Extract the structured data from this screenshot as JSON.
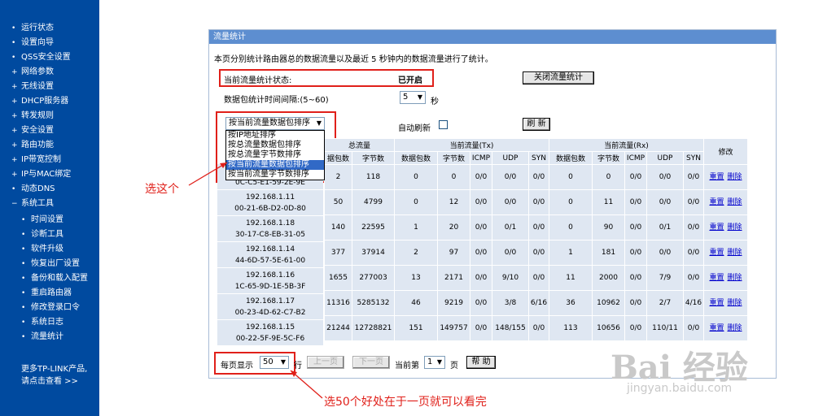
{
  "sidebar": {
    "items": [
      {
        "label": "运行状态",
        "bullet": "•"
      },
      {
        "label": "设置向导",
        "bullet": "•"
      },
      {
        "label": "QSS安全设置",
        "bullet": "•"
      },
      {
        "label": "网络参数",
        "bullet": "+"
      },
      {
        "label": "无线设置",
        "bullet": "+"
      },
      {
        "label": "DHCP服务器",
        "bullet": "+"
      },
      {
        "label": "转发规则",
        "bullet": "+"
      },
      {
        "label": "安全设置",
        "bullet": "+"
      },
      {
        "label": "路由功能",
        "bullet": "+"
      },
      {
        "label": "IP带宽控制",
        "bullet": "+"
      },
      {
        "label": "IP与MAC绑定",
        "bullet": "+"
      },
      {
        "label": "动态DNS",
        "bullet": "•"
      },
      {
        "label": "系统工具",
        "bullet": "−"
      }
    ],
    "sub_items": [
      "时间设置",
      "诊断工具",
      "软件升级",
      "恢复出厂设置",
      "备份和载入配置",
      "重启路由器",
      "修改登录口令",
      "系统日志",
      "流量统计"
    ],
    "more_line1": "更多TP-LINK产品,",
    "more_line2": "请点击查看 >>"
  },
  "panel": {
    "title": "流量统计",
    "description": "本页分别统计路由器总的数据流量以及最近 5 秒钟内的数据流量进行了统计。",
    "status_label": "当前流量统计状态:",
    "status_value": "已开启",
    "close_button": "关闭流量统计",
    "interval_label": "数据包统计时间间隔:(5~60)",
    "interval_value": "5",
    "interval_unit": "秒",
    "sort_selected": "按当前流量数据包排序",
    "auto_refresh_label": "自动刷新",
    "refresh_button": "刷 新",
    "sort_options": [
      "按IP地址排序",
      "按总流量数据包排序",
      "按总流量字节数排序",
      "按当前流量数据包排序",
      "按当前流量字节数排序"
    ],
    "table": {
      "group_total": "总流量",
      "group_tx": "当前流量(Tx)",
      "group_rx": "当前流量(Rx)",
      "group_edit": "修改",
      "sub_total": [
        "据包数",
        "字节数"
      ],
      "sub_current": [
        "数据包数",
        "字节数",
        "ICMP",
        "UDP",
        "SYN"
      ],
      "reset_link": "重置",
      "delete_link": "删除",
      "rows": [
        {
          "ip": "",
          "mac": "0C-C5-E1-59-2E-9E",
          "total_pkts": "2",
          "total_bytes": "118",
          "tx": [
            "0",
            "0",
            "0/0",
            "0/0",
            "0/0"
          ],
          "rx": [
            "0",
            "0",
            "0/0",
            "0/0",
            "0/0"
          ]
        },
        {
          "ip": "192.168.1.11",
          "mac": "00-21-6B-D2-0D-80",
          "total_pkts": "50",
          "total_bytes": "4799",
          "tx": [
            "0",
            "12",
            "0/0",
            "0/0",
            "0/0"
          ],
          "rx": [
            "0",
            "11",
            "0/0",
            "0/0",
            "0/0"
          ]
        },
        {
          "ip": "192.168.1.18",
          "mac": "30-17-C8-EB-31-05",
          "total_pkts": "140",
          "total_bytes": "22595",
          "tx": [
            "1",
            "20",
            "0/0",
            "0/1",
            "0/0"
          ],
          "rx": [
            "0",
            "90",
            "0/0",
            "0/1",
            "0/0"
          ]
        },
        {
          "ip": "192.168.1.14",
          "mac": "44-6D-57-5E-61-00",
          "total_pkts": "377",
          "total_bytes": "37914",
          "tx": [
            "2",
            "97",
            "0/0",
            "0/0",
            "0/0"
          ],
          "rx": [
            "1",
            "181",
            "0/0",
            "0/0",
            "0/0"
          ]
        },
        {
          "ip": "192.168.1.16",
          "mac": "1C-65-9D-1E-5B-3F",
          "total_pkts": "1655",
          "total_bytes": "277003",
          "tx": [
            "13",
            "2171",
            "0/0",
            "9/10",
            "0/0"
          ],
          "rx": [
            "11",
            "2000",
            "0/0",
            "7/9",
            "0/0"
          ]
        },
        {
          "ip": "192.168.1.17",
          "mac": "00-23-4D-62-C7-B2",
          "total_pkts": "11316",
          "total_bytes": "5285132",
          "tx": [
            "46",
            "9219",
            "0/0",
            "3/8",
            "6/16"
          ],
          "rx": [
            "36",
            "10962",
            "0/0",
            "2/7",
            "4/16"
          ]
        },
        {
          "ip": "192.168.1.15",
          "mac": "00-22-5F-9E-5C-F6",
          "total_pkts": "21244",
          "total_bytes": "12728821",
          "tx": [
            "151",
            "149757",
            "0/0",
            "148/155",
            "0/0"
          ],
          "rx": [
            "113",
            "10656",
            "0/0",
            "110/11",
            "0/0"
          ]
        }
      ]
    },
    "pager": {
      "per_page_label": "每页显示",
      "per_page_value": "50",
      "per_page_unit": "行",
      "prev_button": "上一页",
      "next_button": "下一页",
      "current_label": "当前第",
      "current_value": "1",
      "page_unit": "页",
      "help_button": "帮 助"
    }
  },
  "annotations": {
    "pick_this": "选这个",
    "per_page_note": "选50个好处在于一页就可以看完"
  },
  "watermark": {
    "logo": "Bai 经验",
    "url": "jingyan.baidu.com"
  },
  "colors": {
    "sidebar": "#004a9f",
    "title_bar": "#5d8ed0",
    "table_cell": "#dfe7f2",
    "annotation": "#e0201a",
    "highlight": "#3169c6"
  }
}
